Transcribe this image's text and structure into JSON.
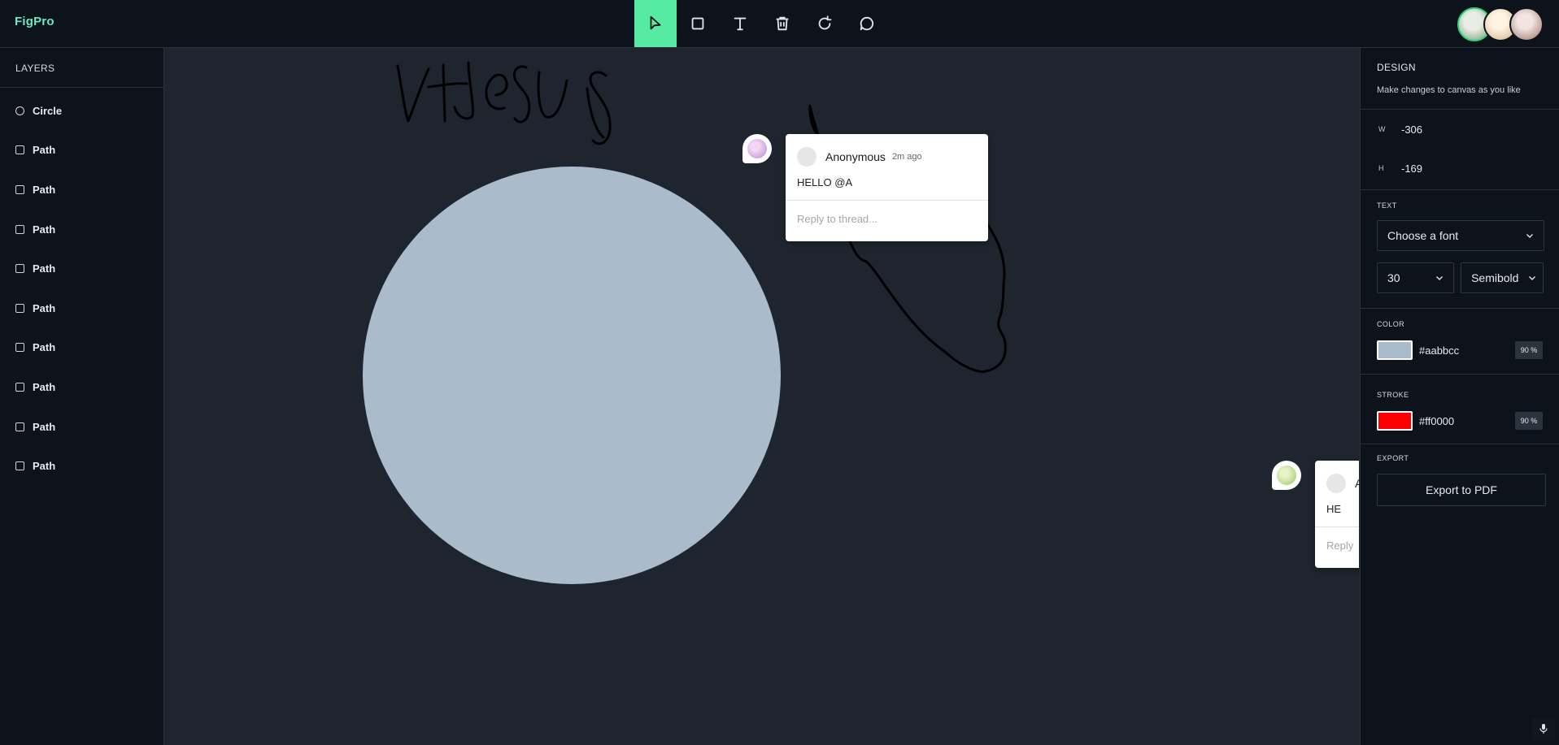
{
  "app": {
    "logo": "FigPro"
  },
  "toolbar": {
    "tools": [
      {
        "name": "select",
        "icon": "cursor-icon",
        "active": true
      },
      {
        "name": "rectangle",
        "icon": "square-icon",
        "active": false
      },
      {
        "name": "text",
        "icon": "text-icon",
        "active": false
      },
      {
        "name": "delete",
        "icon": "trash-icon",
        "active": false
      },
      {
        "name": "reset",
        "icon": "rotate-icon",
        "active": false
      },
      {
        "name": "comments",
        "icon": "comment-icon",
        "active": false
      }
    ],
    "accent": "#56eba2"
  },
  "layers": {
    "title": "LAYERS",
    "items": [
      {
        "label": "Circle",
        "shape": "circle"
      },
      {
        "label": "Path",
        "shape": "square"
      },
      {
        "label": "Path",
        "shape": "square"
      },
      {
        "label": "Path",
        "shape": "square"
      },
      {
        "label": "Path",
        "shape": "square"
      },
      {
        "label": "Path",
        "shape": "square"
      },
      {
        "label": "Path",
        "shape": "square"
      },
      {
        "label": "Path",
        "shape": "square"
      },
      {
        "label": "Path",
        "shape": "square"
      },
      {
        "label": "Path",
        "shape": "square"
      }
    ]
  },
  "canvas": {
    "circle_fill": "#aabbcc",
    "comments": [
      {
        "author": "Anonymous",
        "time": "2m ago",
        "text": "HELLO @A",
        "reply_placeholder": "Reply to thread..."
      },
      {
        "author": "A",
        "text": "HE",
        "reply_placeholder": "Reply"
      }
    ]
  },
  "design": {
    "title": "DESIGN",
    "subtitle": "Make changes to canvas as you like",
    "width_label": "W",
    "width_value": "-306",
    "height_label": "H",
    "height_value": "-169",
    "text_title": "TEXT",
    "font_placeholder": "Choose a font",
    "font_size": "30",
    "font_weight": "Semibold",
    "color_title": "COLOR",
    "fill_hex": "#aabbcc",
    "fill_opacity": "90 %",
    "stroke_title": "STROKE",
    "stroke_hex": "#ff0000",
    "stroke_opacity": "90 %",
    "export_title": "EXPORT",
    "export_label": "Export to PDF"
  }
}
